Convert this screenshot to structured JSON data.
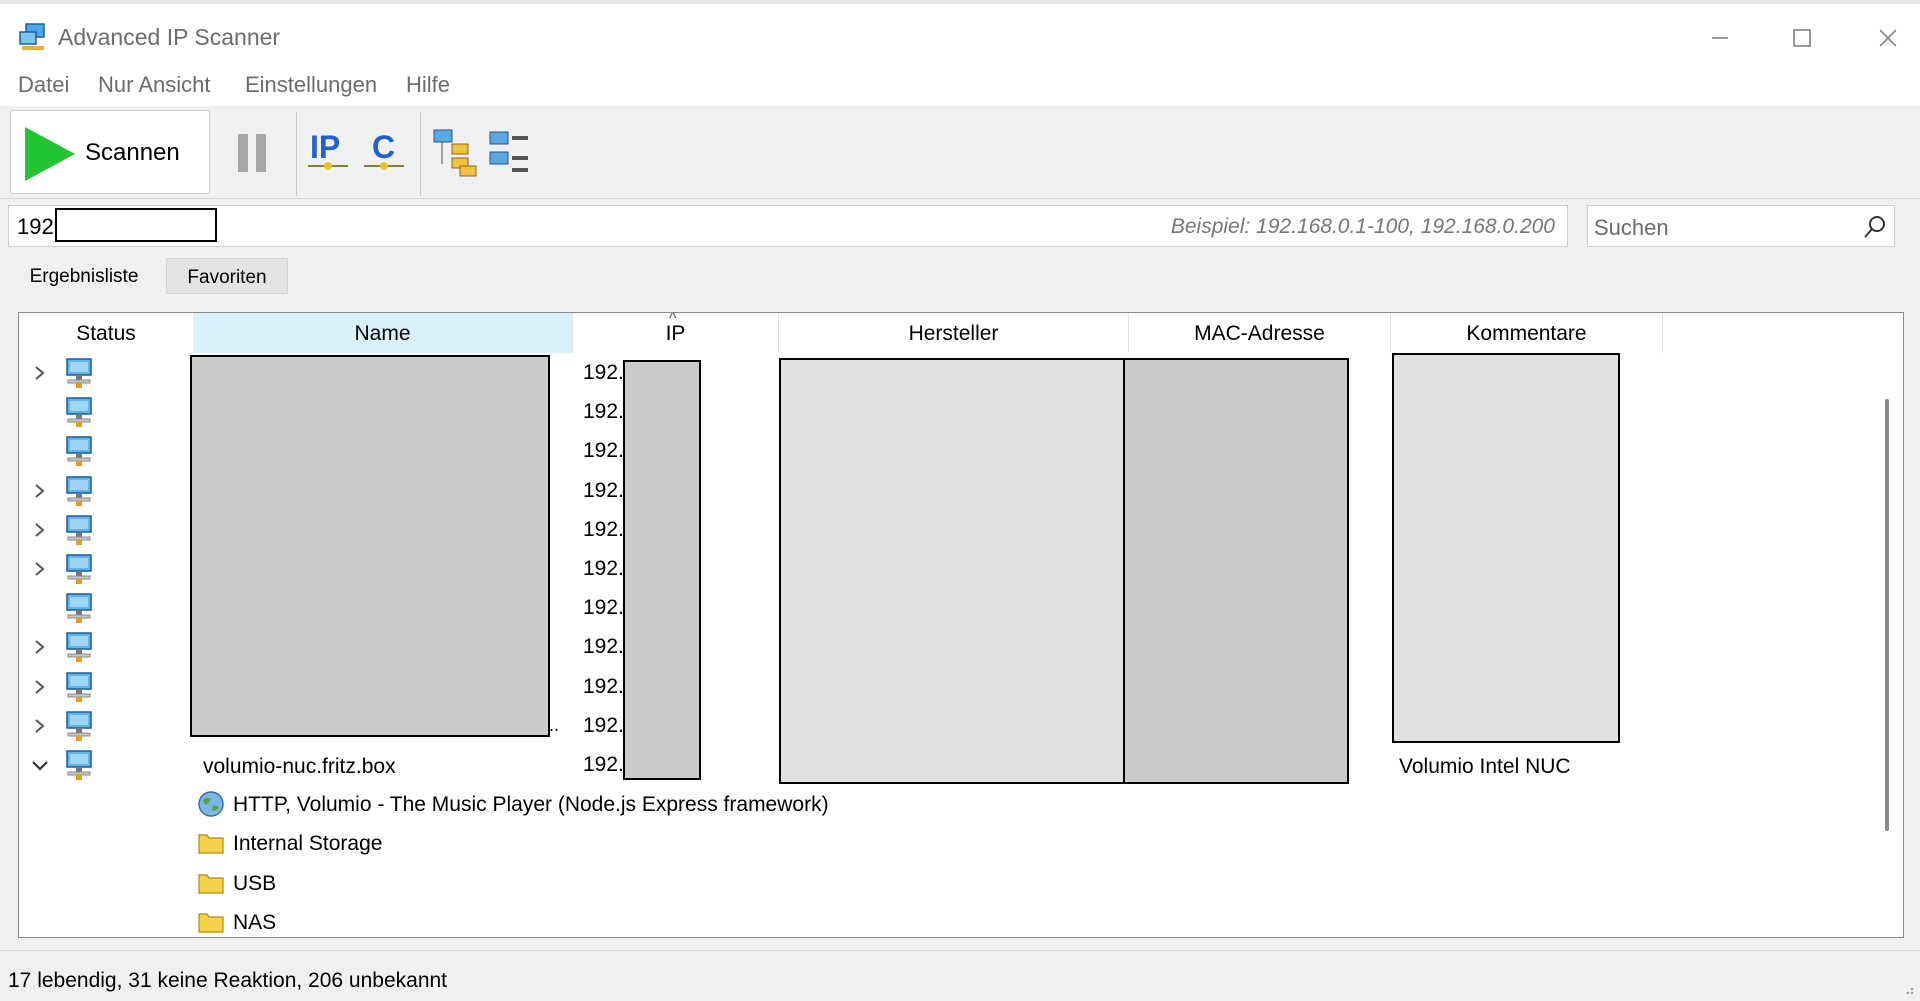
{
  "window": {
    "title": "Advanced IP Scanner",
    "icon": "network-scanner-icon"
  },
  "menu": [
    "Datei",
    "Nur Ansicht",
    "Einstellungen",
    "Hilfe"
  ],
  "toolbar": {
    "scan_label": "Scannen",
    "accent_play": "#22c432",
    "tools": [
      "ip-tool-icon",
      "c-tool-icon",
      "expand-all-icon",
      "collapse-all-icon"
    ]
  },
  "address": {
    "value_prefix": "192",
    "example": "Beispiel: 192.168.0.1-100, 192.168.0.200"
  },
  "search": {
    "placeholder": "Suchen"
  },
  "tabs": [
    "Ergebnisliste",
    "Favoriten"
  ],
  "columns": [
    "Status",
    "Name",
    "IP",
    "Hersteller",
    "MAC-Adresse",
    "Kommentare"
  ],
  "rows": [
    {
      "expandable": "collapsed",
      "ip": "192."
    },
    {
      "expandable": "none",
      "ip": "192."
    },
    {
      "expandable": "none",
      "ip": "192."
    },
    {
      "expandable": "collapsed",
      "ip": "192."
    },
    {
      "expandable": "collapsed",
      "ip": "192."
    },
    {
      "expandable": "collapsed",
      "ip": "192."
    },
    {
      "expandable": "none",
      "ip": "192."
    },
    {
      "expandable": "collapsed",
      "ip": "192."
    },
    {
      "expandable": "collapsed",
      "ip": "192."
    },
    {
      "expandable": "collapsed",
      "ip": "192."
    },
    {
      "expandable": "expanded",
      "ip": "192.",
      "name": "volumio-nuc.fritz.box",
      "comment": "Volumio Intel NUC"
    }
  ],
  "truncation_mark": "..",
  "services": [
    {
      "icon": "globe-icon",
      "label": "HTTP, Volumio - The Music Player (Node.js Express framework)"
    },
    {
      "icon": "folder-icon",
      "label": "Internal Storage"
    },
    {
      "icon": "folder-icon",
      "label": "USB"
    },
    {
      "icon": "folder-icon",
      "label": "NAS"
    }
  ],
  "status": "17 lebendig, 31 keine Reaktion, 206 unbekannt"
}
